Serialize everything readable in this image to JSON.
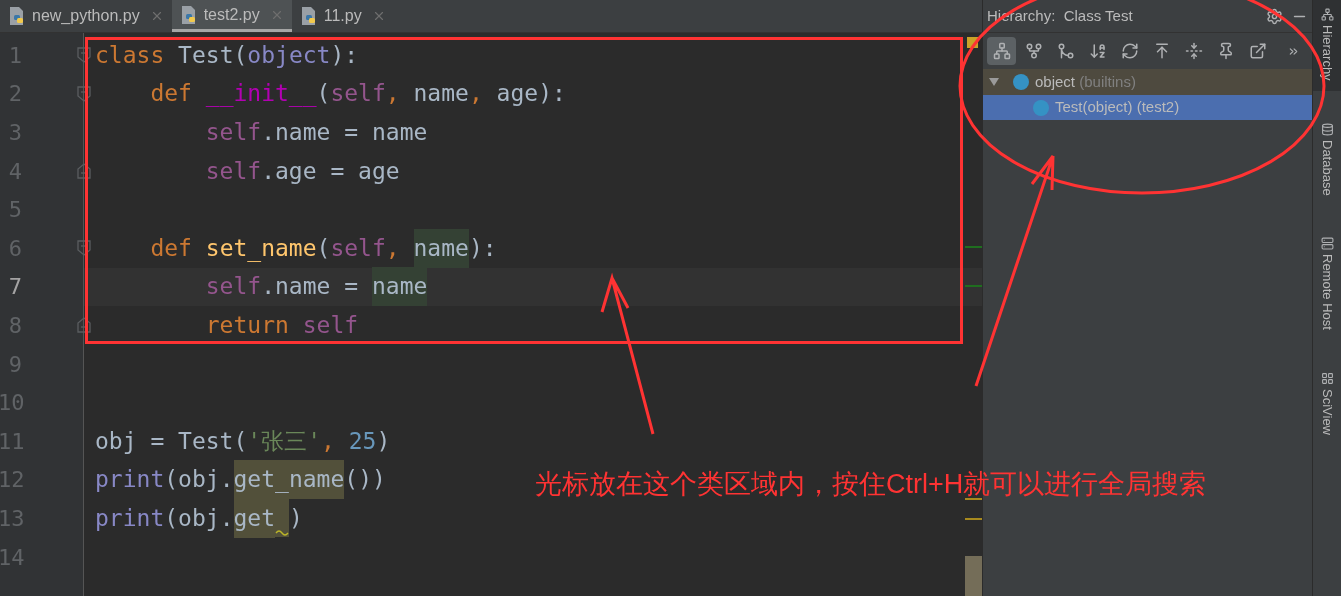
{
  "editor_tabs": [
    {
      "label": "new_python.py",
      "selected": false
    },
    {
      "label": "test2.py",
      "selected": true
    },
    {
      "label": "11.py",
      "selected": false
    }
  ],
  "code_lines": [
    {
      "number": "1",
      "current": false,
      "fold_start": true,
      "fold_end": false,
      "tokens": [
        {
          "text": "class ",
          "kind": "keyword"
        },
        {
          "text": "Test(",
          "kind": "plain"
        },
        {
          "text": "object",
          "kind": "builtin"
        },
        {
          "text": "):",
          "kind": "plain"
        }
      ]
    },
    {
      "number": "2",
      "current": false,
      "fold_start": true,
      "fold_end": false,
      "tokens": [
        {
          "text": "    def ",
          "kind": "keyword"
        },
        {
          "text": "__init__",
          "kind": "magic"
        },
        {
          "text": "(",
          "kind": "plain"
        },
        {
          "text": "self",
          "kind": "self"
        },
        {
          "text": ", ",
          "kind": "comma"
        },
        {
          "text": "name",
          "kind": "plain"
        },
        {
          "text": ", ",
          "kind": "comma"
        },
        {
          "text": "age):",
          "kind": "plain"
        }
      ]
    },
    {
      "number": "3",
      "current": false,
      "fold_start": false,
      "fold_end": false,
      "tokens": [
        {
          "text": "        self",
          "kind": "self"
        },
        {
          "text": ".name = name",
          "kind": "plain"
        }
      ]
    },
    {
      "number": "4",
      "current": false,
      "fold_start": false,
      "fold_end": true,
      "tokens": [
        {
          "text": "        self",
          "kind": "self"
        },
        {
          "text": ".age = age",
          "kind": "plain"
        }
      ]
    },
    {
      "number": "5",
      "current": false,
      "fold_start": false,
      "fold_end": false
    },
    {
      "number": "6",
      "current": false,
      "fold_start": true,
      "fold_end": false,
      "tokens": [
        {
          "text": "    def ",
          "kind": "keyword"
        },
        {
          "text": "set_name",
          "kind": "func"
        },
        {
          "text": "(",
          "kind": "plain"
        },
        {
          "text": "self",
          "kind": "self"
        },
        {
          "text": ", ",
          "kind": "comma"
        },
        {
          "text": "name",
          "kind": "write_usage"
        },
        {
          "text": "):",
          "kind": "plain"
        }
      ]
    },
    {
      "number": "7",
      "current": true,
      "fold_start": false,
      "fold_end": false,
      "tokens": [
        {
          "text": "        self",
          "kind": "self"
        },
        {
          "text": ".name = ",
          "kind": "plain"
        },
        {
          "text": "name",
          "kind": "write_usage"
        }
      ]
    },
    {
      "number": "8",
      "current": false,
      "fold_start": false,
      "fold_end": true,
      "tokens": [
        {
          "text": "        return ",
          "kind": "keyword"
        },
        {
          "text": "self",
          "kind": "self"
        }
      ]
    },
    {
      "number": "9",
      "current": false,
      "fold_start": false,
      "fold_end": false
    },
    {
      "number": "10",
      "current": false,
      "fold_start": false,
      "fold_end": false
    },
    {
      "number": "11",
      "current": false,
      "fold_start": false,
      "fold_end": false,
      "tokens": [
        {
          "text": "obj = Test(",
          "kind": "plain"
        },
        {
          "text": "'张三'",
          "kind": "string"
        },
        {
          "text": ", ",
          "kind": "comma"
        },
        {
          "text": "25",
          "kind": "number"
        },
        {
          "text": ")",
          "kind": "plain"
        }
      ]
    },
    {
      "number": "12",
      "current": false,
      "fold_start": false,
      "fold_end": false,
      "tokens": [
        {
          "text": "print",
          "kind": "builtin"
        },
        {
          "text": "(obj.",
          "kind": "plain"
        },
        {
          "text": "get_name",
          "kind": "read_usage"
        },
        {
          "text": "())",
          "kind": "plain"
        }
      ]
    },
    {
      "number": "13",
      "current": false,
      "fold_start": false,
      "fold_end": false,
      "tokens": [
        {
          "text": "print",
          "kind": "builtin"
        },
        {
          "text": "(obj.",
          "kind": "plain"
        },
        {
          "text": "get",
          "kind": "read_usage"
        },
        {
          "kind": "squiggle"
        },
        {
          "text": ")",
          "kind": "plain"
        }
      ]
    },
    {
      "number": "14",
      "current": false,
      "fold_start": false,
      "fold_end": false
    }
  ],
  "hierarchy": {
    "title": "Hierarchy:  Class Test",
    "tools": [
      {
        "kind": "subtypes",
        "selected": true
      },
      {
        "kind": "supertypes",
        "selected": false
      },
      {
        "kind": "hierarchy",
        "selected": false
      },
      {
        "kind": "sort",
        "selected": false
      },
      {
        "kind": "refresh",
        "selected": false
      },
      {
        "kind": "root",
        "selected": false
      },
      {
        "kind": "expand",
        "selected": false
      },
      {
        "kind": "pin",
        "selected": false
      },
      {
        "kind": "export",
        "selected": false
      },
      {
        "kind": "more",
        "selected": false
      }
    ],
    "tree": [
      {
        "name": "object",
        "detail": "(builtins)",
        "expanded": true,
        "selected": false,
        "children": [
          {
            "name": "Test(object) (test2)",
            "selected": true
          }
        ]
      }
    ]
  },
  "side_tabs": [
    {
      "label": "Hierarchy",
      "kind": "hierarchy",
      "selected": true
    },
    {
      "label": "Database",
      "kind": "database",
      "selected": false
    },
    {
      "label": "Remote Host",
      "kind": "remote",
      "selected": false
    },
    {
      "label": "SciView",
      "kind": "sciview",
      "selected": false
    }
  ],
  "annotation": {
    "text": "光标放在这个类区域内，按住Ctrl+H就可以进行全局搜索"
  }
}
